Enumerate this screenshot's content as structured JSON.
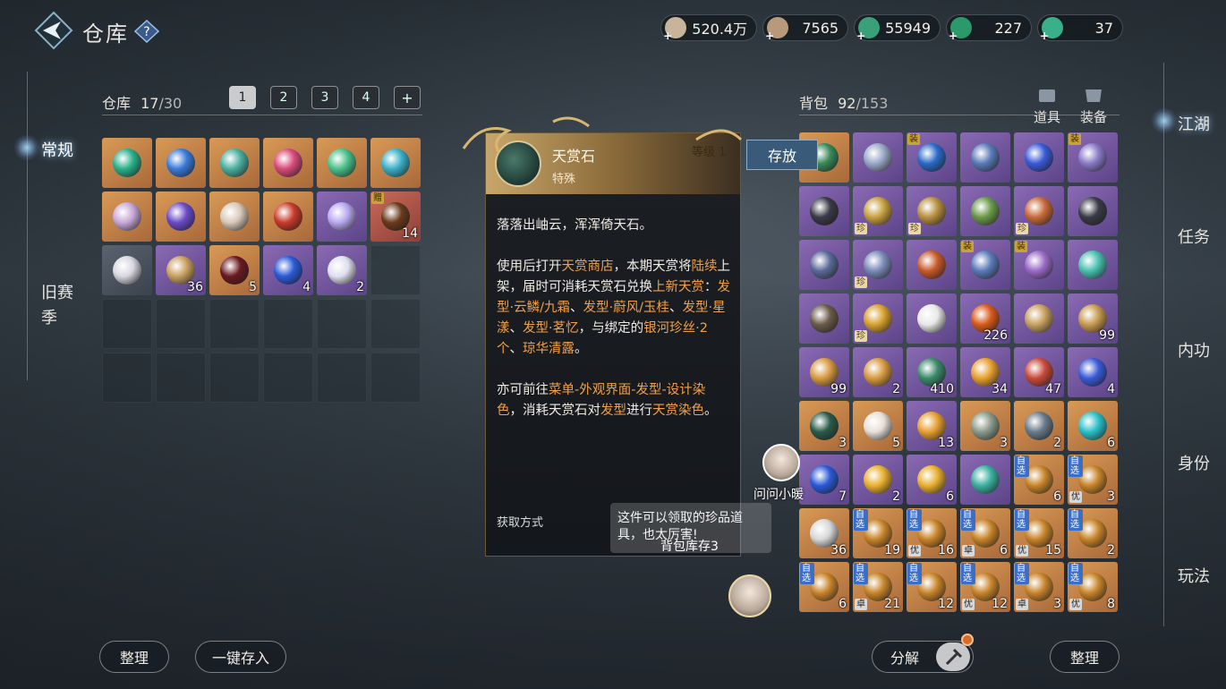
{
  "header": {
    "title": "仓库",
    "currencies": [
      {
        "icon": "scroll-currency-icon",
        "value": "520.4万",
        "color": "#c8b49a"
      },
      {
        "icon": "coin-currency-icon",
        "value": "7565",
        "color": "#b89a7a"
      },
      {
        "icon": "jade-link-icon",
        "value": "55949",
        "color": "#3aa07a"
      },
      {
        "icon": "jade-coin-icon",
        "value": "227",
        "color": "#2a9a6a"
      },
      {
        "icon": "jade-token-icon",
        "value": "37",
        "color": "#3ab08a"
      }
    ]
  },
  "left_nav": {
    "items": [
      {
        "label": "常规",
        "active": true
      },
      {
        "label": "旧赛季",
        "active": false
      }
    ]
  },
  "right_nav": {
    "items": [
      "江湖",
      "任务",
      "内功",
      "身份",
      "玩法"
    ]
  },
  "warehouse": {
    "label": "仓库",
    "used": "17",
    "capacity": "/30",
    "tabs": [
      "1",
      "2",
      "3",
      "4",
      ""
    ],
    "slots": [
      {
        "rarity": "orange",
        "gem": "#2ab08a",
        "count": ""
      },
      {
        "rarity": "orange",
        "gem": "#3a7ad8",
        "count": ""
      },
      {
        "rarity": "orange",
        "gem": "#4ab0a0",
        "count": ""
      },
      {
        "rarity": "orange",
        "gem": "#d84a7a",
        "count": ""
      },
      {
        "rarity": "orange",
        "gem": "#4ac08a",
        "count": ""
      },
      {
        "rarity": "orange",
        "gem": "#3ab0c8",
        "count": ""
      },
      {
        "rarity": "orange",
        "gem": "#c8a8d8",
        "count": ""
      },
      {
        "rarity": "orange",
        "gem": "#6a4ac8",
        "count": ""
      },
      {
        "rarity": "orange",
        "gem": "#d8c8b8",
        "count": ""
      },
      {
        "rarity": "orange",
        "gem": "#c83a2a",
        "count": ""
      },
      {
        "rarity": "purple",
        "gem": "#b8a8f0",
        "count": ""
      },
      {
        "rarity": "red",
        "gem": "#6a3a1a",
        "count": "14",
        "tag": "赠"
      },
      {
        "rarity": "gray",
        "gem": "#d8d8e0",
        "count": ""
      },
      {
        "rarity": "purple",
        "gem": "#c8a060",
        "count": "36"
      },
      {
        "rarity": "orange",
        "gem": "#6a1a20",
        "count": "5"
      },
      {
        "rarity": "purple",
        "gem": "#2a5ad8",
        "count": "4"
      },
      {
        "rarity": "purple",
        "gem": "#e0e0f0",
        "count": "2"
      },
      {
        "rarity": "empty"
      },
      {
        "rarity": "empty"
      },
      {
        "rarity": "empty"
      },
      {
        "rarity": "empty"
      },
      {
        "rarity": "empty"
      },
      {
        "rarity": "empty"
      },
      {
        "rarity": "empty"
      },
      {
        "rarity": "empty"
      },
      {
        "rarity": "empty"
      },
      {
        "rarity": "empty"
      },
      {
        "rarity": "empty"
      },
      {
        "rarity": "empty"
      },
      {
        "rarity": "empty"
      }
    ]
  },
  "bag": {
    "label": "背包",
    "used": "92",
    "capacity": "/153",
    "filters": [
      "道具",
      "装备"
    ],
    "slots": [
      {
        "rarity": "orange",
        "gem": "#3a8a5a",
        "count": ""
      },
      {
        "rarity": "purple",
        "gem": "#9aa8c8",
        "count": ""
      },
      {
        "rarity": "purple",
        "gem": "#2a6ac8",
        "count": "",
        "tag": "装"
      },
      {
        "rarity": "purple",
        "gem": "#5a7ab8",
        "count": ""
      },
      {
        "rarity": "purple",
        "gem": "#3a5ad8",
        "count": ""
      },
      {
        "rarity": "purple",
        "gem": "#8a7ac8",
        "count": "",
        "tag": "装"
      },
      {
        "rarity": "purple",
        "gem": "#3a3a48",
        "count": ""
      },
      {
        "rarity": "purple",
        "gem": "#c8a040",
        "count": "",
        "zhen": "珍"
      },
      {
        "rarity": "purple",
        "gem": "#b89040",
        "count": "",
        "zhen": "珍"
      },
      {
        "rarity": "purple",
        "gem": "#6a9a4a",
        "count": ""
      },
      {
        "rarity": "purple",
        "gem": "#c86a3a",
        "count": "",
        "zhen": "珍"
      },
      {
        "rarity": "purple",
        "gem": "#3a3a48",
        "count": ""
      },
      {
        "rarity": "purple",
        "gem": "#5a6a98",
        "count": ""
      },
      {
        "rarity": "purple",
        "gem": "#7a8ab8",
        "count": "",
        "zhen": "珍"
      },
      {
        "rarity": "purple",
        "gem": "#c85a2a",
        "count": ""
      },
      {
        "rarity": "purple",
        "gem": "#5a7ab8",
        "count": "",
        "tag": "装"
      },
      {
        "rarity": "purple",
        "gem": "#9a6ac8",
        "count": "",
        "tag": "装"
      },
      {
        "rarity": "purple",
        "gem": "#4ac0b0",
        "count": ""
      },
      {
        "rarity": "purple",
        "gem": "#6a5a4a",
        "count": ""
      },
      {
        "rarity": "purple",
        "gem": "#d8a030",
        "count": "",
        "zhen": "珍"
      },
      {
        "rarity": "purple",
        "gem": "#e8e8e8",
        "count": ""
      },
      {
        "rarity": "purple",
        "gem": "#d85a1a",
        "count": "226"
      },
      {
        "rarity": "purple",
        "gem": "#c8a060",
        "count": ""
      },
      {
        "rarity": "purple",
        "gem": "#c89a50",
        "count": "99"
      },
      {
        "rarity": "purple",
        "gem": "#d89a40",
        "count": "99"
      },
      {
        "rarity": "purple",
        "gem": "#d89a40",
        "count": "2"
      },
      {
        "rarity": "purple",
        "gem": "#3a8a6a",
        "count": "410"
      },
      {
        "rarity": "purple",
        "gem": "#e8a030",
        "count": "34"
      },
      {
        "rarity": "purple",
        "gem": "#c84a3a",
        "count": "47"
      },
      {
        "rarity": "purple",
        "gem": "#3a5ad8",
        "count": "4"
      },
      {
        "rarity": "orange",
        "gem": "#2a5a4a",
        "count": "3"
      },
      {
        "rarity": "orange",
        "gem": "#e8e0d8",
        "count": "5"
      },
      {
        "rarity": "purple",
        "gem": "#e8a030",
        "count": "13"
      },
      {
        "rarity": "orange",
        "gem": "#8a9a8a",
        "count": "3"
      },
      {
        "rarity": "orange",
        "gem": "#6a7a8a",
        "count": "2"
      },
      {
        "rarity": "orange",
        "gem": "#2ac0c8",
        "count": "6"
      },
      {
        "rarity": "purple",
        "gem": "#2a5ad8",
        "count": "7"
      },
      {
        "rarity": "purple",
        "gem": "#e8b030",
        "count": "2"
      },
      {
        "rarity": "purple",
        "gem": "#e8b030",
        "count": "6"
      },
      {
        "rarity": "purple",
        "gem": "#3ab0a0",
        "count": ""
      },
      {
        "rarity": "orange",
        "gem": "#c8842a",
        "count": "6",
        "tag": "自选"
      },
      {
        "rarity": "orange",
        "gem": "#c8842a",
        "count": "3",
        "tag": "自选",
        "you": "优"
      },
      {
        "rarity": "orange",
        "gem": "#d8d8d8",
        "count": "36"
      },
      {
        "rarity": "orange",
        "gem": "#c8842a",
        "count": "19",
        "tag": "自选"
      },
      {
        "rarity": "orange",
        "gem": "#c8842a",
        "count": "16",
        "tag": "自选",
        "you": "优"
      },
      {
        "rarity": "orange",
        "gem": "#c8842a",
        "count": "6",
        "tag": "自选",
        "you": "卓"
      },
      {
        "rarity": "orange",
        "gem": "#c8842a",
        "count": "15",
        "tag": "自选",
        "you": "优"
      },
      {
        "rarity": "orange",
        "gem": "#c8842a",
        "count": "2",
        "tag": "自选"
      },
      {
        "rarity": "orange",
        "gem": "#c8842a",
        "count": "6",
        "tag": "自选"
      },
      {
        "rarity": "orange",
        "gem": "#c8842a",
        "count": "21",
        "tag": "自选",
        "you": "卓"
      },
      {
        "rarity": "orange",
        "gem": "#c8842a",
        "count": "12",
        "tag": "自选"
      },
      {
        "rarity": "orange",
        "gem": "#c8842a",
        "count": "12",
        "tag": "自选",
        "you": "优"
      },
      {
        "rarity": "orange",
        "gem": "#c8842a",
        "count": "3",
        "tag": "自选",
        "you": "卓"
      },
      {
        "rarity": "orange",
        "gem": "#c8842a",
        "count": "8",
        "tag": "自选",
        "you": "优"
      }
    ]
  },
  "tooltip": {
    "name": "天赏石",
    "type": "特殊",
    "level_label": "等级 1",
    "desc1": "落落出岫云，浑浑倚天石。",
    "desc2_parts": [
      "使用后打开",
      "天赏商店",
      "，本期天赏将",
      "陆续",
      "上架，届时可消耗天赏石兑换",
      "上新天赏",
      "：",
      "发型·云鳞/九霜",
      "、",
      "发型·蔚风/玉桂",
      "、",
      "发型·星漾",
      "、",
      "发型·茗忆",
      "，与绑定的",
      "银河珍丝·2个",
      "、",
      "琼华清露",
      "。"
    ],
    "desc3_parts": [
      "亦可前往",
      "菜单-外观界面-发型-设计染色",
      "，消耗天赏石对",
      "发型",
      "进行",
      "天赏染色",
      "。"
    ],
    "footer": "获取方式"
  },
  "deposit_button": "存放",
  "bubble_text": "这件可以领取的珍品道具，也太厉害!",
  "bubble_caption": "背包库存3",
  "assistant_label": "问问小暖",
  "buttons": {
    "wh_sort": "整理",
    "wh_deposit_all": "一键存入",
    "decompose": "分解",
    "bag_sort": "整理"
  }
}
